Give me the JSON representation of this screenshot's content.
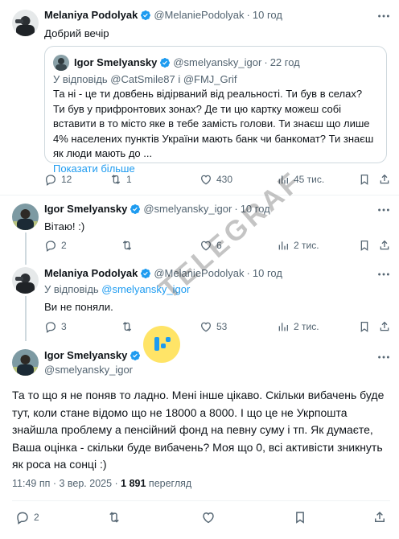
{
  "tweets": [
    {
      "author_name": "Melaniya Podolyak",
      "handle": "@MelaniePodolyak",
      "dot": "·",
      "time": "10 год",
      "text": "Добрий вечір",
      "quote": {
        "author_name": "Igor Smelyansky",
        "handle": "@smelyansky_igor",
        "dot": "·",
        "time": "22 год",
        "reply_prefix": "У відповідь ",
        "reply_mention_1": "@CatSmile87",
        "reply_joiner": " і ",
        "reply_mention_2": "@FMJ_Grif",
        "text": "Та ні - це ти довбень відірваний від реальності. Ти був в селах? Ти був у прифронтових зонах? Де ти цю картку можеш собі вставити в то місто яке в тебе замість голови. Ти знаєш що лише 4% населених пунктів України мають банк чи банкомат? Ти знаєш як люди мають до ...",
        "show_more": "Показати більше"
      },
      "replies": "12",
      "reposts": "1",
      "likes": "430",
      "views": "45 тис."
    },
    {
      "author_name": "Igor Smelyansky",
      "handle": "@smelyansky_igor",
      "dot": "·",
      "time": "10 год",
      "text": "Вітаю! :)",
      "replies": "2",
      "reposts": "",
      "likes": "6",
      "views": "2 тис."
    },
    {
      "author_name": "Melaniya Podolyak",
      "handle": "@MelaniePodolyak",
      "dot": "·",
      "time": "10 год",
      "reply_prefix": "У відповідь ",
      "reply_mention": "@smelyansky_igor",
      "text": "Ви не поняли.",
      "replies": "3",
      "reposts": "",
      "likes": "53",
      "views": "2 тис."
    }
  ],
  "main_tweet": {
    "author_name": "Igor Smelyansky",
    "handle": "@smelyansky_igor",
    "text": "Та то що я не поняв то ладно. Мені інше цікаво. Скільки вибачень буде тут, коли стане відомо що не 18000 а 8000. І що це не Укрпошта знайшла проблему а пенсійний фонд на певну суму і тп. Як думаєте, Ваша оцінка - скільки буде вибачень? Моя що 0, всі активісти зникнуть як роса на сонці :)",
    "timestamp": "11:49 пп · 3 вер. 2025 · ",
    "views_count": "1 891",
    "views_label": " перегляд",
    "replies": "2"
  },
  "watermark": "TELEGRAF",
  "icons": {
    "verified": "verified-badge-icon",
    "more": "more-options-icon",
    "reply": "reply-icon",
    "repost": "repost-icon",
    "like": "like-icon",
    "views": "views-icon",
    "bookmark": "bookmark-icon",
    "share": "share-icon"
  },
  "colors": {
    "accent": "#1d9bf0",
    "text": "#0f1419",
    "muted": "#536471",
    "border": "#cfd9de"
  }
}
